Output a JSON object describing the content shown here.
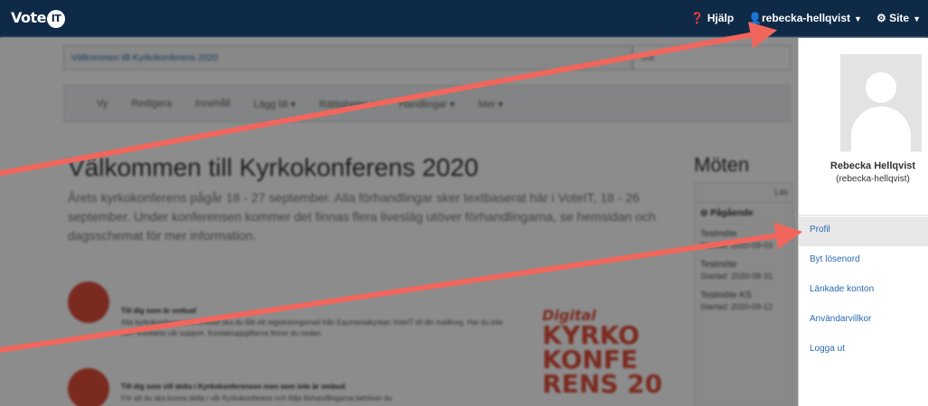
{
  "nav": {
    "brand": "Vote",
    "brand_badge": "IT",
    "help": "Hjälp",
    "user": "rebecka-hellqvist",
    "site": "Site"
  },
  "content": {
    "crumb": "Välkommen till Kyrkokonferens 2020",
    "crumb_right": "Sök",
    "tabs": [
      "Vy",
      "Redigera",
      "Innehåll",
      "Lägg till ▾",
      "Rättigheter ▾",
      "Handlingar ▾",
      "Mer ▾"
    ],
    "title": "Välkommen till Kyrkokonferens 2020",
    "lead": "Årets kyrkokonferens pågår 18 - 27 september. Alla förhandlingar sker textbaserat här i VoteIT, 18 - 26 september. Under konferensen kommer det finnas flera livesläg utöver förhandlingarna, se hemsidan och dagsschemat för mer information.",
    "announcements": [
      {
        "title": "Till dig som är ombud",
        "body": "Alla kyrkokonferensens ombud ska du fått ett registreringsmail från Equmeniakyrkan VoteIT till din mailkorg. Har du inte det? Kontakta vår support. Kontaktuppgifterna finner du nedan."
      },
      {
        "title": "Till dig som vill delta i Kyrkokonferensen men som inte är ombud",
        "body": "För att du ska kunna delta i vår Kyrkokonferens och följa förhandlingarna behöver du"
      }
    ],
    "logo": {
      "script": "Digital",
      "lines": [
        "KYRKO",
        "KONFE",
        "RENS 20"
      ]
    },
    "meetings": {
      "title": "Möten",
      "strip": "Läs",
      "ongoing": "Pågående",
      "items": [
        {
          "name": "Testmöte",
          "started": "Startad: 2020-09-03"
        },
        {
          "name": "Testmöte",
          "started": "Startad: 2020-08-31"
        },
        {
          "name": "Testmöte KS",
          "started": "Startad: 2020-09-12"
        }
      ]
    }
  },
  "dropdown": {
    "name": "Rebecka Hellqvist",
    "handle": "(rebecka-hellqvist)",
    "items": [
      "Profil",
      "Byt lösenord",
      "Länkade konton",
      "Användarvillkor",
      "Logga ut"
    ]
  },
  "colors": {
    "navbar": "#0f2a47",
    "arrow": "#f1665c",
    "accent": "#e04e3a",
    "link": "#2a6ab0"
  }
}
